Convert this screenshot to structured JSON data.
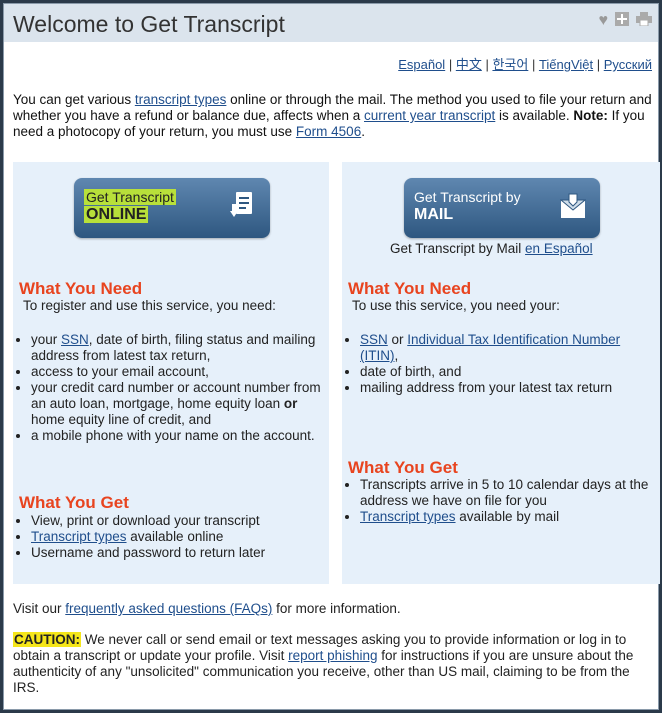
{
  "header": {
    "title": "Welcome to Get Transcript"
  },
  "icons": [
    "heart-icon",
    "plus-icon",
    "print-icon"
  ],
  "languages": [
    "Español",
    "中文",
    "한국어",
    "TiếngViệt",
    "Русский"
  ],
  "intro": {
    "t1": "You can get various ",
    "l1": "transcript types",
    "t2": " online or through the mail. The method you used to file your return and whether you have a refund or balance due, affects when a ",
    "l2": "current year transcript",
    "t3": " is available. ",
    "note": "Note:",
    "t4": " If you need a photocopy of your return, you must use ",
    "l3": "Form 4506",
    "t5": "."
  },
  "online": {
    "btn1": "Get Transcript",
    "btn2": "ONLINE",
    "need_title": "What You Need",
    "need_sub": "To register and use this service, you need:",
    "need_items": {
      "i1a": "your ",
      "i1l": "SSN",
      "i1b": ", date of birth, filing status and mailing address from latest tax return,",
      "i2": "access to your email account,",
      "i3a": "your credit card number or account number from an auto loan, mortgage, home equity loan ",
      "i3or": "or",
      "i3b": " home equity line of credit, and",
      "i4": "a mobile phone with your name on the account."
    },
    "get_title": "What You Get",
    "get_items": {
      "g1": "View, print or download your transcript",
      "g2l": "Transcript types",
      "g2": " available online",
      "g3": "Username and password to return later"
    }
  },
  "mail": {
    "btn1": "Get Transcript by",
    "btn2": "MAIL",
    "by_text": "Get Transcript by Mail ",
    "by_link": "en Español",
    "need_title": "What You Need",
    "need_sub": "To use this service, you need your:",
    "need_items": {
      "i1l": "SSN",
      "i1a": " or ",
      "i1l2": "Individual Tax Identification Number (ITIN)",
      "i1b": ",",
      "i2": "date of birth, and",
      "i3": "mailing address from your latest tax return"
    },
    "get_title": "What You Get",
    "get_items": {
      "g1": "Transcripts arrive in 5 to 10 calendar days at  the  address we have on file for you",
      "g2l": "Transcript types",
      "g2": " available by mail"
    }
  },
  "faq": {
    "t1": "Visit our ",
    "link": "frequently asked questions (FAQs)",
    "t2": " for more information."
  },
  "caution": {
    "label": "CAUTION:",
    "t1": " We never call or send email or text messages asking you to provide information or log in to obtain a transcript or update your profile. Visit ",
    "link": "report phishing",
    "t2": " for instructions if you are unsure about the authenticity of any \"unsolicited\" communication you receive, other than US mail, claiming to be from the IRS."
  }
}
